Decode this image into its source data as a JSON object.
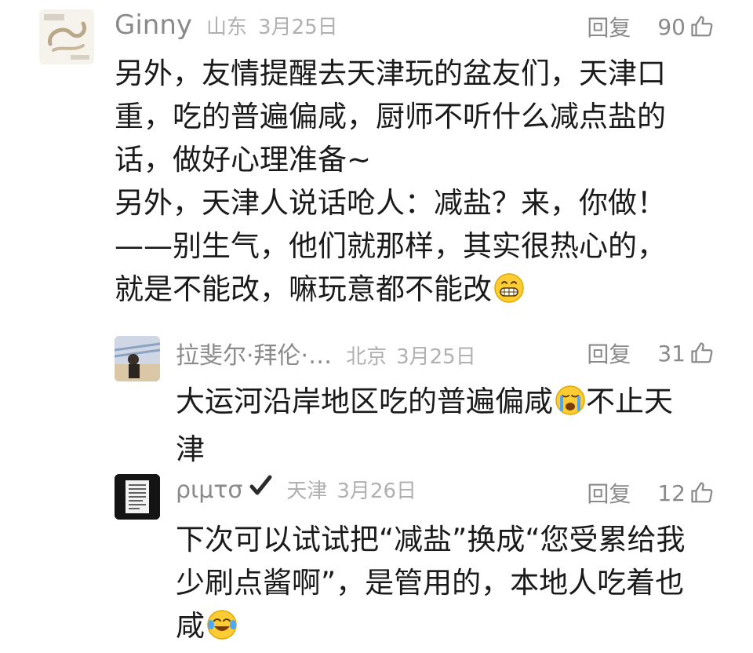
{
  "comments": [
    {
      "user": "Ginny",
      "region": "山东",
      "date": "3月25日",
      "reply_label": "回复",
      "likes": "90",
      "lines": [
        "另外，友情提醒去天津玩的盆友们，天津口",
        "重，吃的普遍偏咸，厨师不听什么减点盐的",
        "话，做好心理准备~",
        "另外，天津人说话呛人：减盐？来，你做！",
        "——别生气，他们就那样，其实很热心的，",
        "就是不能改，嘛玩意都不能改"
      ]
    },
    {
      "user": "拉斐尔·拜伦·…",
      "region": "北京",
      "date": "3月25日",
      "reply_label": "回复",
      "likes": "31",
      "line1_a": "大运河沿岸地区吃的普遍偏咸",
      "line1_b": "不止天",
      "line2": "津"
    },
    {
      "user": "ριμτσ",
      "region": "天津",
      "date": "3月26日",
      "reply_label": "回复",
      "likes": "12",
      "lines": [
        "下次可以试试把“减盐”换成“您受累给我",
        "少刷点酱啊”，是管用的，本地人吃着也",
        "咸"
      ]
    }
  ],
  "icons": {
    "like": "thumbs-up-icon",
    "verified": "checkmark-icon",
    "emoji_grin": "grinning-emoji",
    "emoji_cry": "loudly-crying-emoji",
    "emoji_joy": "tears-of-joy-emoji"
  }
}
